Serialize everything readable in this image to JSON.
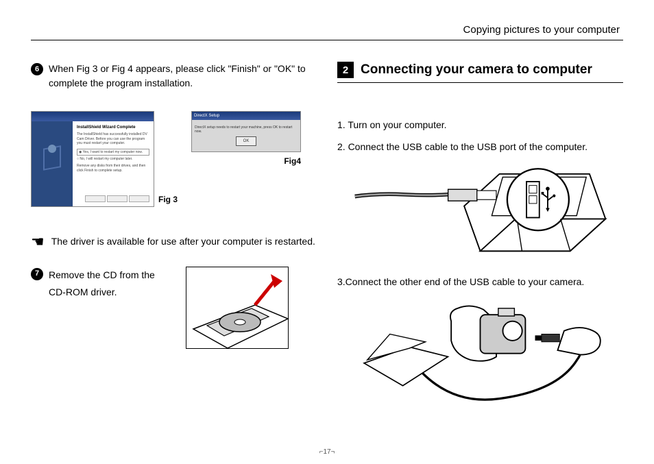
{
  "header": {
    "title": "Copying pictures to your computer"
  },
  "left": {
    "step6": {
      "num": "6",
      "text": "When Fig 3 or Fig 4 appears, please click \"Finish\" or \"OK\" to complete the program installation."
    },
    "fig3": {
      "caption": "Fig 3",
      "win_title": "InstallShield Wizard Complete",
      "body1": "The InstallShield has successfully installed DV Cam Driver. Before you can use the program you must restart your computer.",
      "opt1": "Yes, I want to restart my computer now.",
      "opt2": "No, I will restart my computer later.",
      "body2": "Remove any disks from their drives, and then click Finish to complete setup."
    },
    "fig4": {
      "caption": "Fig4",
      "win_title": "DirectX Setup",
      "body": "DirectX setup needs to restart your machine, press OK to restart now.",
      "ok": "OK"
    },
    "hand_note": "The driver is available for use after your computer is restarted.",
    "step7": {
      "num": "7",
      "text": "Remove the CD from the CD-ROM driver."
    }
  },
  "right": {
    "section_num": "2",
    "section_title": "Connecting your camera to computer",
    "step1": "1. Turn on your computer.",
    "step2": "2. Connect the USB cable to the USB port of the computer.",
    "step3": "3.Connect the other end of the USB cable to your camera."
  },
  "page_number": "17"
}
